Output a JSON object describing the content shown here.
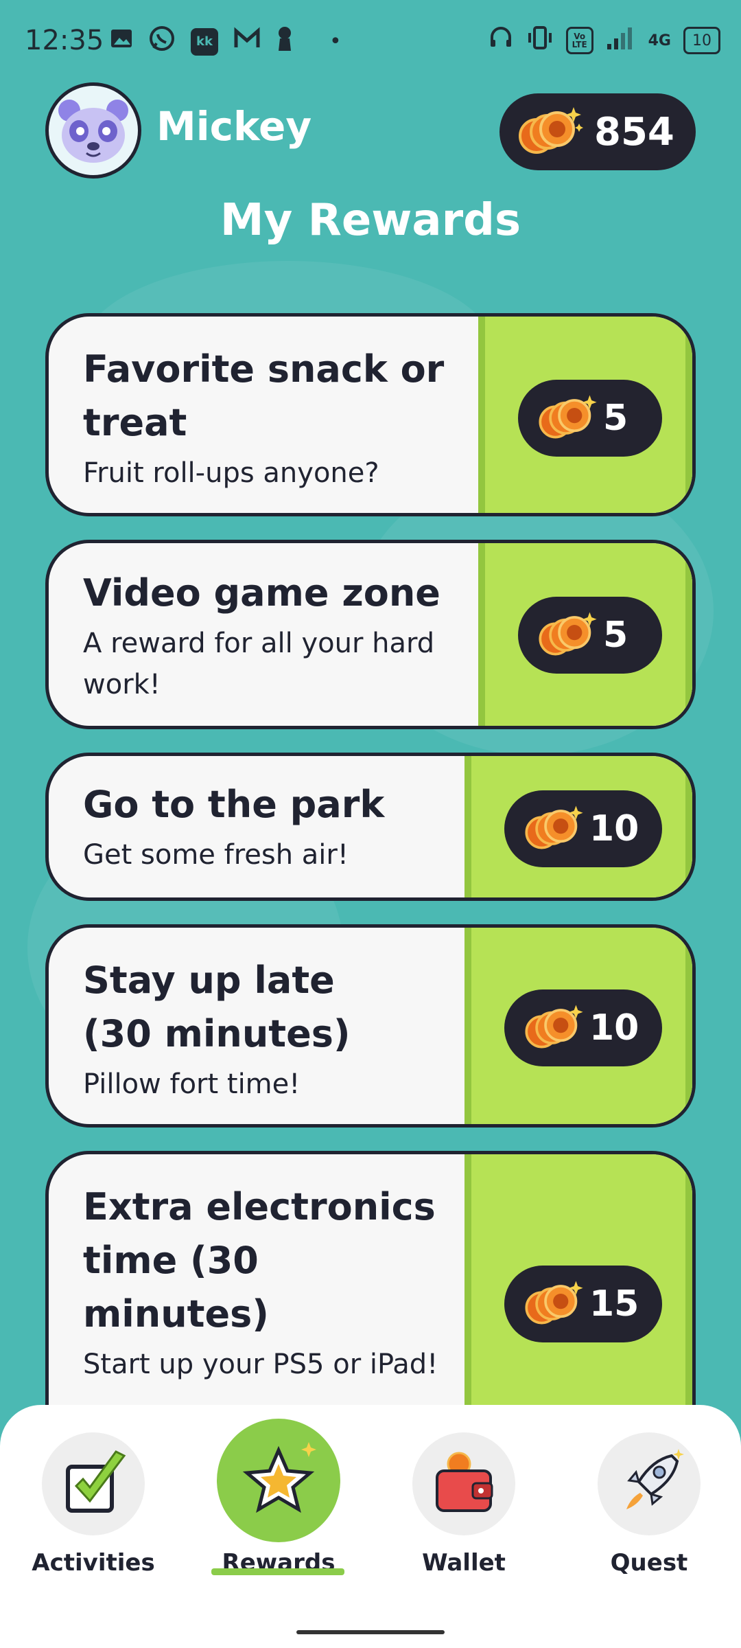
{
  "status_bar": {
    "time": "12:35",
    "battery": "10",
    "network": "4G",
    "volte": "Vo LTE",
    "icons": [
      "image-icon",
      "whatsapp-icon",
      "kk-app-icon",
      "gmail-icon",
      "keyhole-icon",
      "dot-icon",
      "headset-icon",
      "vibrate-icon",
      "volte-icon",
      "signal-icon",
      "battery-icon"
    ]
  },
  "header": {
    "username": "Mickey",
    "coin_balance": "854",
    "avatar_icon": "panda-avatar-icon"
  },
  "page_title": "My Rewards",
  "rewards": [
    {
      "name": "Favorite snack or treat",
      "desc": "Fruit roll-ups anyone?",
      "cost": "5"
    },
    {
      "name": "Video game zone",
      "desc": "A reward for all your hard work!",
      "cost": "5"
    },
    {
      "name": "Go to the park",
      "desc": "Get some fresh air!",
      "cost": "10"
    },
    {
      "name": "Stay up late (30 minutes)",
      "desc": "Pillow fort time!",
      "cost": "10"
    },
    {
      "name": "Extra electronics time (30 minutes)",
      "desc": "Start up your PS5 or iPad!",
      "cost": "15"
    }
  ],
  "nav": {
    "items": [
      {
        "label": "Activities",
        "icon": "checkbox-icon"
      },
      {
        "label": "Rewards",
        "icon": "star-icon"
      },
      {
        "label": "Wallet",
        "icon": "wallet-icon"
      },
      {
        "label": "Quest",
        "icon": "rocket-icon"
      }
    ],
    "active": "Rewards"
  },
  "colors": {
    "background": "#4bb9b3",
    "card_green": "#b6e255",
    "pill_dark": "#23232f",
    "coin_orange": "#f07d20",
    "active_nav": "#8bcc4a"
  }
}
